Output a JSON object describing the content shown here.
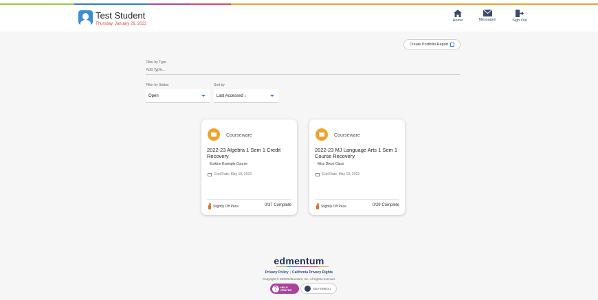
{
  "header": {
    "student_name": "Test Student",
    "date": "Thursday, January 26, 2023",
    "stripe_colors": [
      "#a3c44a",
      "#f0a22a",
      "#2c7ad6",
      "#a8459b",
      "#e6405f",
      "#f4c430"
    ],
    "nav": [
      {
        "label": "Home",
        "icon": "home-icon"
      },
      {
        "label": "Messages",
        "icon": "envelope-icon"
      },
      {
        "label": "Sign Out",
        "icon": "sign-out-icon"
      }
    ]
  },
  "toolbar": {
    "portfolio_label": "Create Portfolio Report"
  },
  "filters": {
    "type_label": "Filter by Type",
    "type_placeholder": "Add type...",
    "status_label": "Filter by Status",
    "status_value": "Open",
    "sort_label": "Sort by",
    "sort_value": "Last Accessed ↓"
  },
  "cards": [
    {
      "type": "Courseware",
      "title": "2022-23 Algebra 1 Sem 1 Credit Recovery",
      "subtitle": "Erskine Example Course",
      "end_date": "End Date: May 19, 2023",
      "pace": "Slightly Off Pace",
      "complete": "0/37 Complete"
    },
    {
      "type": "Courseware",
      "title": "2022-23 MJ Language Arts 1 Sem 1 Course Recovery",
      "subtitle": "Miss Dixon Class",
      "end_date": "End Date: May 19, 2023",
      "pace": "Slightly Off Pace",
      "complete": "0/29 Complete"
    }
  ],
  "footer": {
    "logo": "edmentum",
    "privacy_policy": "Privacy Policy",
    "separator": "|",
    "california_privacy": "California Privacy Rights",
    "copyright": "Copyright © 2023 Edmentum, Inc. All rights reserved.",
    "help_line1": "HELP",
    "help_line2": "CENTER",
    "help_q": "?",
    "enroll_label": "SELF ENROLL"
  }
}
